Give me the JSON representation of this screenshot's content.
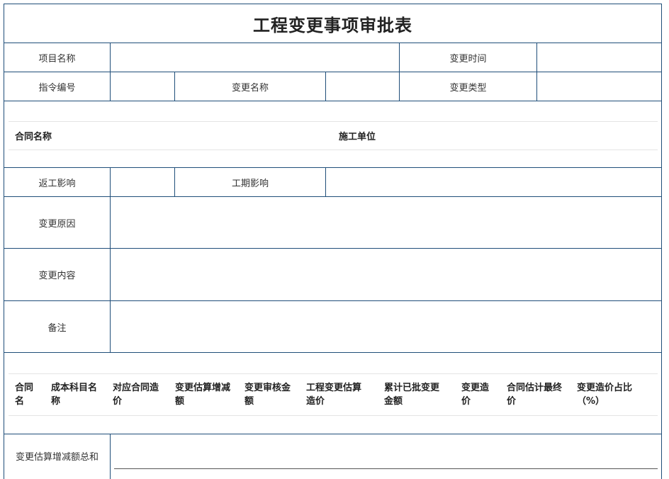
{
  "title": "工程变更事项审批表",
  "row1": {
    "project_name_label": "项目名称",
    "change_time_label": "变更时间"
  },
  "row2": {
    "instruction_no_label": "指令编号",
    "change_name_label": "变更名称",
    "change_type_label": "变更类型"
  },
  "contract_section": {
    "contract_name_label": "合同名称",
    "construction_unit_label": "施工单位"
  },
  "row_impact": {
    "rework_label": "返工影响",
    "schedule_label": "工期影响"
  },
  "change_reason_label": "变更原因",
  "change_content_label": "变更内容",
  "remarks_label": "备注",
  "cost_table": {
    "headers": [
      "合同名",
      "成本科目名称",
      "对应合同造价",
      "变更估算增减额",
      "变更审核金额",
      "工程变更估算造价",
      "累计已批变更金额",
      "变更造价",
      "合同估计最终价",
      "变更造价占比（%）"
    ]
  },
  "total_label": "变更估算增减额总和"
}
